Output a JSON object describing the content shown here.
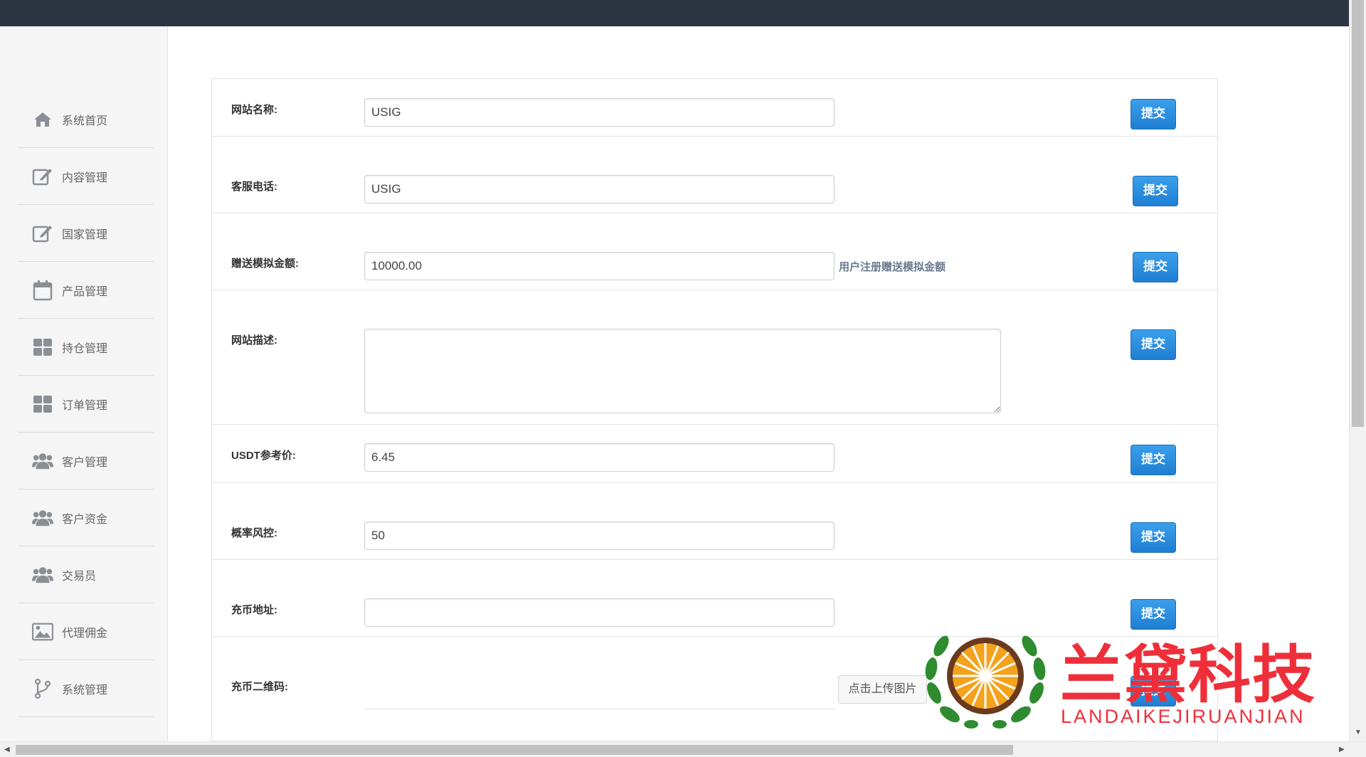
{
  "sidebar": {
    "items": [
      {
        "label": "系统首页",
        "icon": "home-icon"
      },
      {
        "label": "内容管理",
        "icon": "edit-icon"
      },
      {
        "label": "国家管理",
        "icon": "edit-icon"
      },
      {
        "label": "产品管理",
        "icon": "calendar-icon"
      },
      {
        "label": "持仓管理",
        "icon": "grid-icon"
      },
      {
        "label": "订单管理",
        "icon": "grid-icon"
      },
      {
        "label": "客户管理",
        "icon": "users-icon"
      },
      {
        "label": "客户资金",
        "icon": "users-icon"
      },
      {
        "label": "交易员",
        "icon": "users-icon"
      },
      {
        "label": "代理佣金",
        "icon": "image-icon"
      },
      {
        "label": "系统管理",
        "icon": "branch-icon"
      }
    ]
  },
  "form": {
    "rows": [
      {
        "label": "网站名称:",
        "value": "USIG",
        "button": "提交"
      },
      {
        "label": "客服电话:",
        "value": "USIG",
        "button": "提交"
      },
      {
        "label": "赠送模拟金额:",
        "value": "10000.00",
        "hint": "用户注册赠送模拟金额",
        "button": "提交"
      },
      {
        "label": "网站描述:",
        "value": "",
        "button": "提交"
      },
      {
        "label": "USDT参考价:",
        "value": "6.45",
        "button": "提交"
      },
      {
        "label": "概率风控:",
        "value": "50",
        "button": "提交"
      },
      {
        "label": "充币地址:",
        "value": "",
        "button": "提交"
      },
      {
        "label": "充币二维码:",
        "upload": "点击上传图片",
        "button": "提交"
      }
    ]
  },
  "watermark": {
    "cn": "兰黛科技",
    "en": "LANDAIKEJIRUANJIAN",
    "color": "#ee2f3a"
  },
  "colors": {
    "topbar": "#2b3441",
    "button": "#1f7fd3"
  }
}
